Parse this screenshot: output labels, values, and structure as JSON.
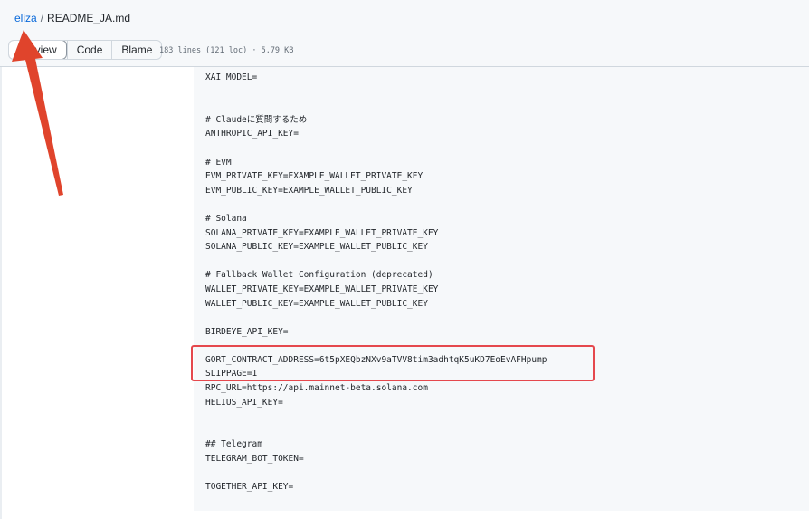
{
  "breadcrumb": {
    "repo": "eliza",
    "separator": "/",
    "file": "README_JA.md"
  },
  "toolbar": {
    "tabs": [
      {
        "label": "Preview",
        "active": true
      },
      {
        "label": "Code",
        "active": false
      },
      {
        "label": "Blame",
        "active": false
      }
    ],
    "file_meta": "183 lines (121 loc) · 5.79 KB"
  },
  "code": {
    "lines": [
      "XAI_MODEL=",
      "",
      "",
      "# Claudeに質問するため",
      "ANTHROPIC_API_KEY=",
      "",
      "# EVM",
      "EVM_PRIVATE_KEY=EXAMPLE_WALLET_PRIVATE_KEY",
      "EVM_PUBLIC_KEY=EXAMPLE_WALLET_PUBLIC_KEY",
      "",
      "# Solana",
      "SOLANA_PRIVATE_KEY=EXAMPLE_WALLET_PRIVATE_KEY",
      "SOLANA_PUBLIC_KEY=EXAMPLE_WALLET_PUBLIC_KEY",
      "",
      "# Fallback Wallet Configuration (deprecated)",
      "WALLET_PRIVATE_KEY=EXAMPLE_WALLET_PRIVATE_KEY",
      "WALLET_PUBLIC_KEY=EXAMPLE_WALLET_PUBLIC_KEY",
      "",
      "BIRDEYE_API_KEY=",
      "",
      "GORT_CONTRACT_ADDRESS=6t5pXEQbzNXv9aTVV8tim3adhtqK5uKD7EoEvAFHpump",
      "SLIPPAGE=1",
      "RPC_URL=https://api.mainnet-beta.solana.com",
      "HELIUS_API_KEY=",
      "",
      "",
      "## Telegram",
      "TELEGRAM_BOT_TOKEN=",
      "",
      "TOGETHER_API_KEY="
    ]
  },
  "annotations": {
    "highlight_color": "#e5484d",
    "arrow_color": "#e0442c"
  }
}
